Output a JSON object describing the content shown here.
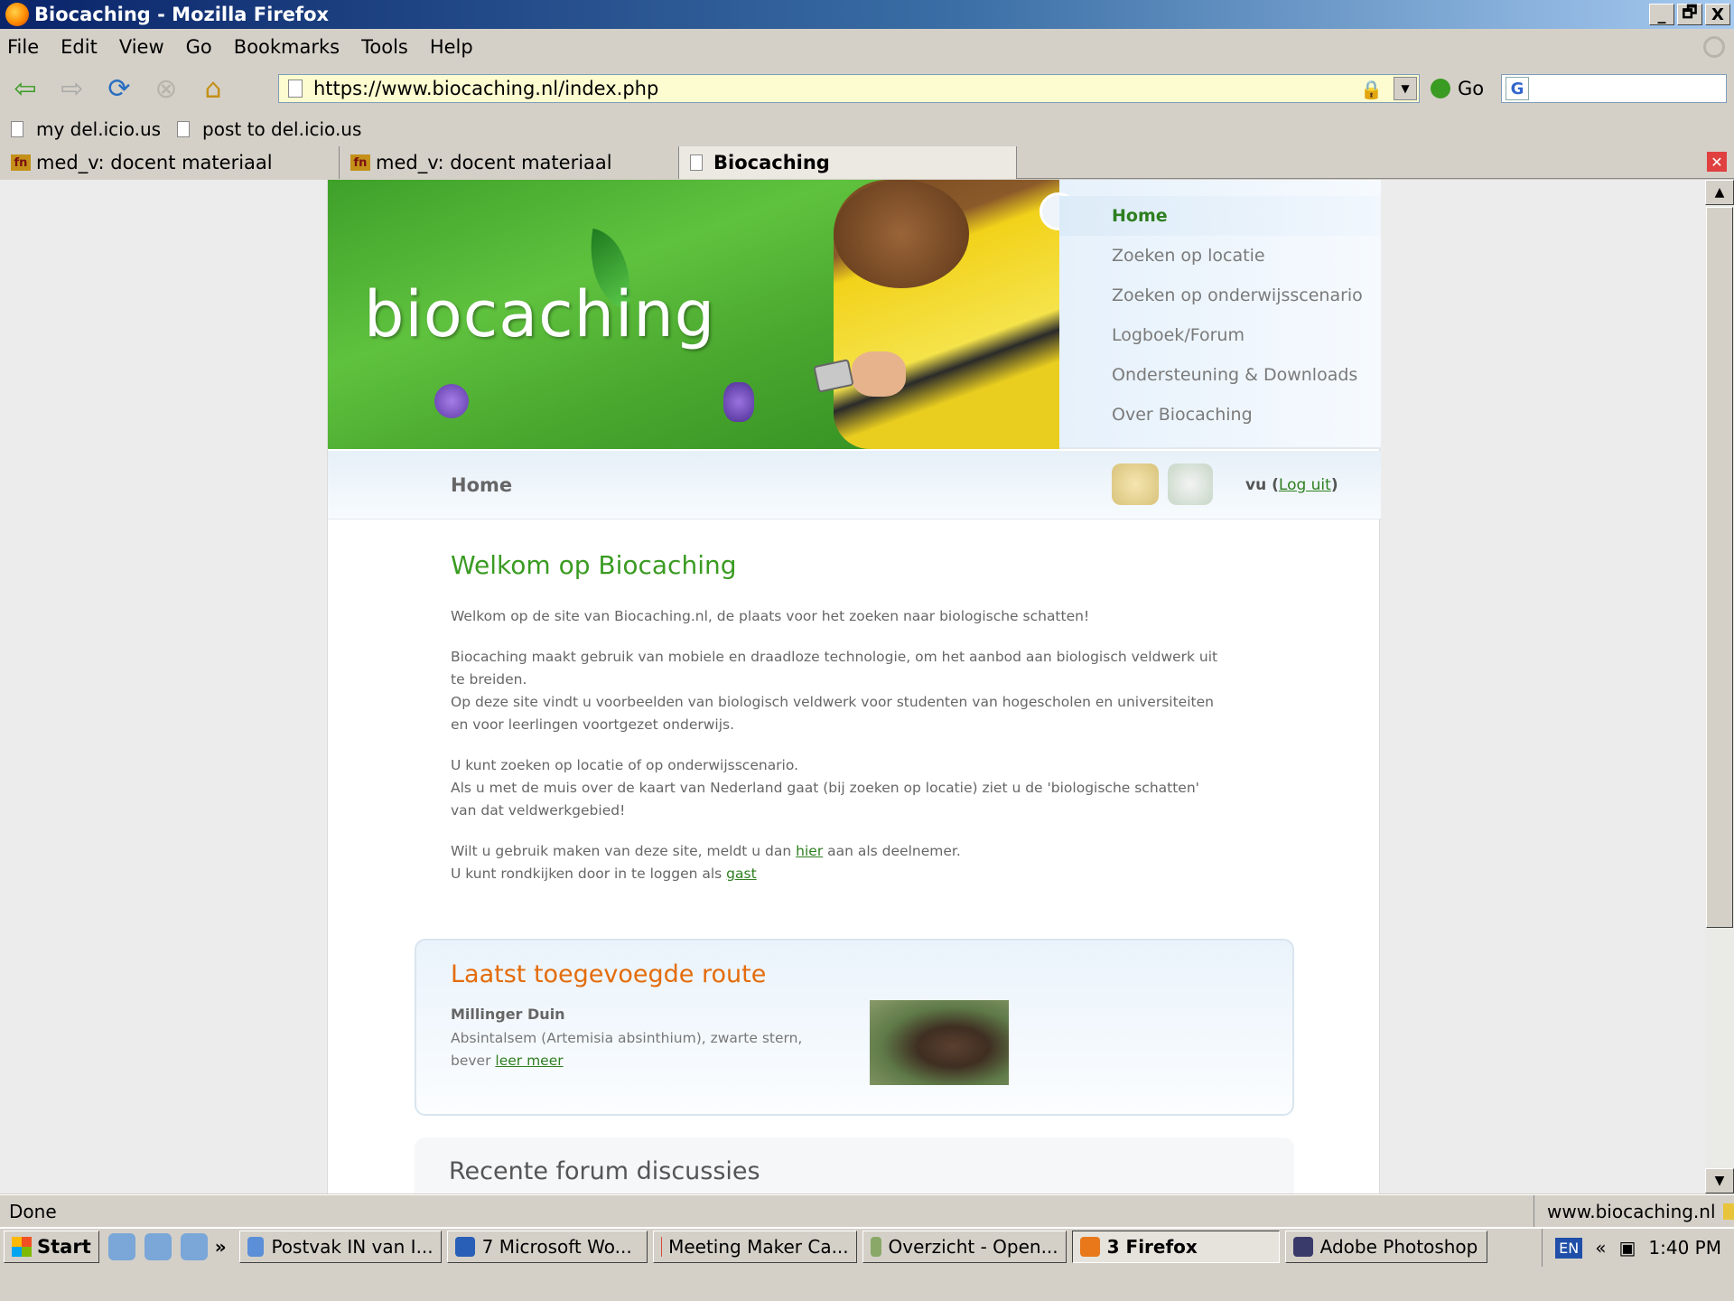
{
  "window": {
    "title": "Biocaching - Mozilla Firefox",
    "minimize": "_",
    "restore": "🗗",
    "close": "X"
  },
  "menu": {
    "items": [
      "File",
      "Edit",
      "View",
      "Go",
      "Bookmarks",
      "Tools",
      "Help"
    ]
  },
  "navigation": {
    "url": "https://www.biocaching.nl/index.php",
    "go_label": "Go",
    "search_icon": "G"
  },
  "bookmarks": {
    "items": [
      "my del.icio.us",
      "post to del.icio.us"
    ]
  },
  "tabs": [
    {
      "label": "med_v: docent materiaal",
      "icon": "fn"
    },
    {
      "label": "med_v: docent materiaal",
      "icon": "fn"
    },
    {
      "label": "Biocaching"
    }
  ],
  "site": {
    "logo": "biocaching",
    "nav": [
      "Home",
      "Zoeken op locatie",
      "Zoeken op onderwijsscenario",
      "Logboek/Forum",
      "Ondersteuning & Downloads",
      "Over Biocaching"
    ],
    "breadcrumb": "Home",
    "user": "vu",
    "logout_label": "Log uit",
    "welcome_title": "Welkom op Biocaching",
    "para1": "Welkom op de site van Biocaching.nl, de plaats voor het zoeken naar biologische schatten!",
    "para2a": "Biocaching maakt gebruik van mobiele en draadloze technologie, om het aanbod aan biologisch veldwerk uit te breiden.",
    "para2b": "Op deze site vindt u voorbeelden van biologisch veldwerk voor studenten van hogescholen en universiteiten en voor leerlingen voortgezet onderwijs.",
    "para3a": "U kunt zoeken op locatie of op onderwijsscenario.",
    "para3b": "Als u met de muis over de kaart van Nederland gaat (bij zoeken op locatie) ziet u de 'biologische schatten' van dat veldwerkgebied!",
    "para4a_pre": "Wilt u gebruik maken van deze site, meldt u dan ",
    "para4a_link": "hier",
    "para4a_post": " aan als deelnemer.",
    "para4b_pre": "U kunt rondkijken door in te loggen als ",
    "para4b_link": "gast",
    "route_title": "Laatst toegevoegde route",
    "route_name": "Millinger Duin",
    "route_desc": "Absintalsem (Artemisia absinthium), zwarte stern, bever ",
    "route_more": "leer meer",
    "forum_title": "Recente forum discussies"
  },
  "status": {
    "text": "Done",
    "host": "www.biocaching.nl"
  },
  "taskbar": {
    "start": "Start",
    "chevron": "»",
    "tasks": [
      "Postvak IN van I...",
      "7 Microsoft Wo...",
      "Meeting Maker Ca...",
      "Overzicht - Open...",
      "3 Firefox",
      "Adobe Photoshop"
    ],
    "lang": "EN",
    "tray_chevron": "«",
    "clock": "1:40 PM"
  }
}
